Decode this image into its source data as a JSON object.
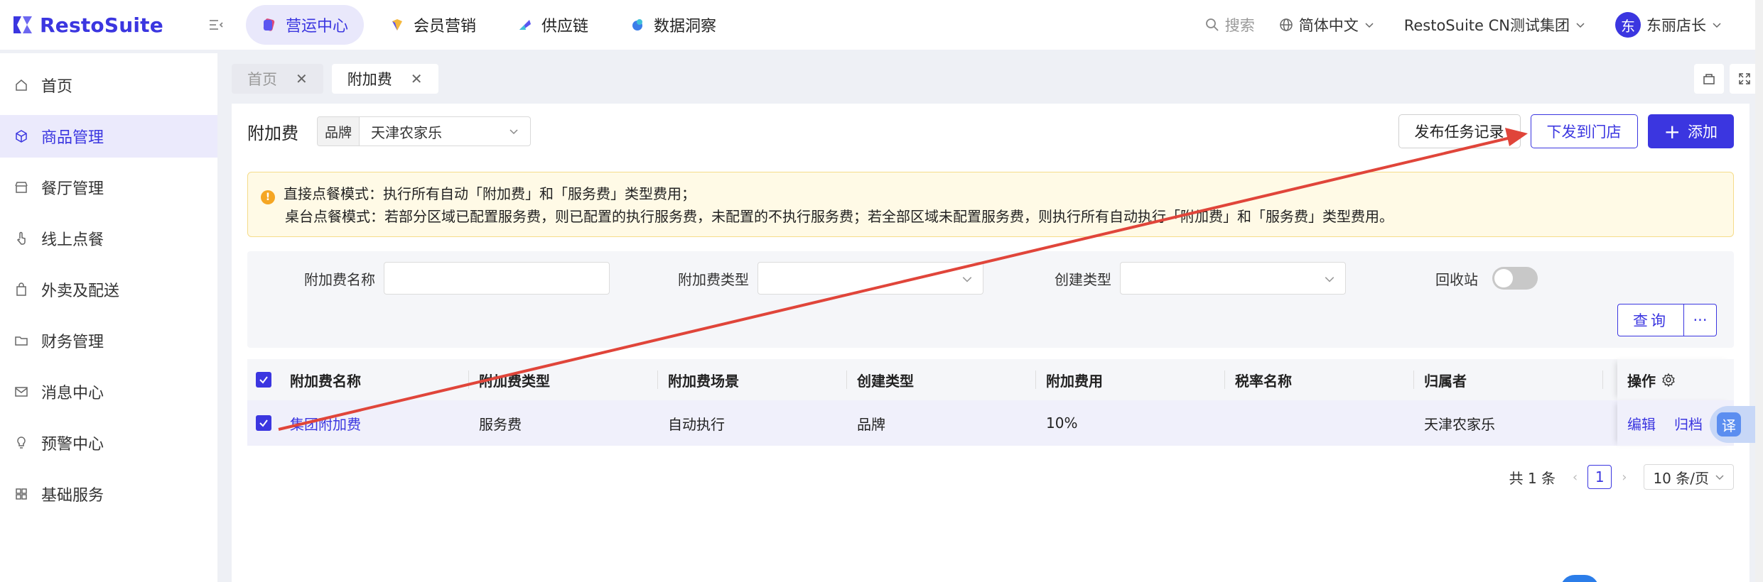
{
  "app": {
    "logo_text": "RestoSuite"
  },
  "colors": {
    "primary": "#3b36e0",
    "annotation_arrow": "#e0453a",
    "warning": "#f5a623"
  },
  "topnav": [
    {
      "label": "营运中心",
      "icon": "ops-center-icon",
      "active": true
    },
    {
      "label": "会员营销",
      "icon": "member-marketing-icon",
      "active": false
    },
    {
      "label": "供应链",
      "icon": "supply-chain-icon",
      "active": false
    },
    {
      "label": "数据洞察",
      "icon": "data-insight-icon",
      "active": false
    }
  ],
  "topright": {
    "search": "搜索",
    "language": "简体中文",
    "group": "RestoSuite CN测试集团",
    "avatar_char": "东",
    "user": "东丽店长"
  },
  "sidebar": {
    "items": [
      {
        "label": "首页",
        "icon": "home-icon"
      },
      {
        "label": "商品管理",
        "icon": "box-icon",
        "active": true
      },
      {
        "label": "餐厅管理",
        "icon": "store-icon"
      },
      {
        "label": "线上点餐",
        "icon": "hand-pointer-icon"
      },
      {
        "label": "外卖及配送",
        "icon": "bag-icon"
      },
      {
        "label": "财务管理",
        "icon": "folder-icon"
      },
      {
        "label": "消息中心",
        "icon": "mail-icon"
      },
      {
        "label": "预警中心",
        "icon": "bulb-icon"
      },
      {
        "label": "基础服务",
        "icon": "grid-icon"
      }
    ]
  },
  "tabs": [
    {
      "label": "首页",
      "active": false
    },
    {
      "label": "附加费",
      "active": true
    }
  ],
  "page": {
    "title": "附加费",
    "brand_label": "品牌",
    "brand_value": "天津农家乐",
    "actions": {
      "publish_log": "发布任务记录",
      "dispatch": "下发到门店",
      "add": "添加"
    }
  },
  "alert": {
    "line1": "直接点餐模式：执行所有自动「附加费」和「服务费」类型费用；",
    "line2": "桌台点餐模式：若部分区域已配置服务费，则已配置的执行服务费，未配置的不执行服务费；若全部区域未配置服务费，则执行所有自动执行「附加费」和「服务费」类型费用。"
  },
  "filters": {
    "name_label": "附加费名称",
    "type_label": "附加费类型",
    "create_type_label": "创建类型",
    "recycle_label": "回收站",
    "query": "查询",
    "more": "···"
  },
  "table": {
    "headers": [
      "附加费名称",
      "附加费类型",
      "附加费场景",
      "创建类型",
      "附加费用",
      "税率名称",
      "归属者"
    ],
    "ops_header": "操作",
    "rows": [
      {
        "name": "集团附加费",
        "type": "服务费",
        "scene": "自动执行",
        "create_type": "品牌",
        "fee": "10%",
        "tax": "",
        "owner": "天津农家乐",
        "edit": "编辑",
        "archive": "归档"
      }
    ]
  },
  "pagination": {
    "total": "共 1 条",
    "current": "1",
    "page_size": "10 条/页"
  },
  "translate": "译"
}
